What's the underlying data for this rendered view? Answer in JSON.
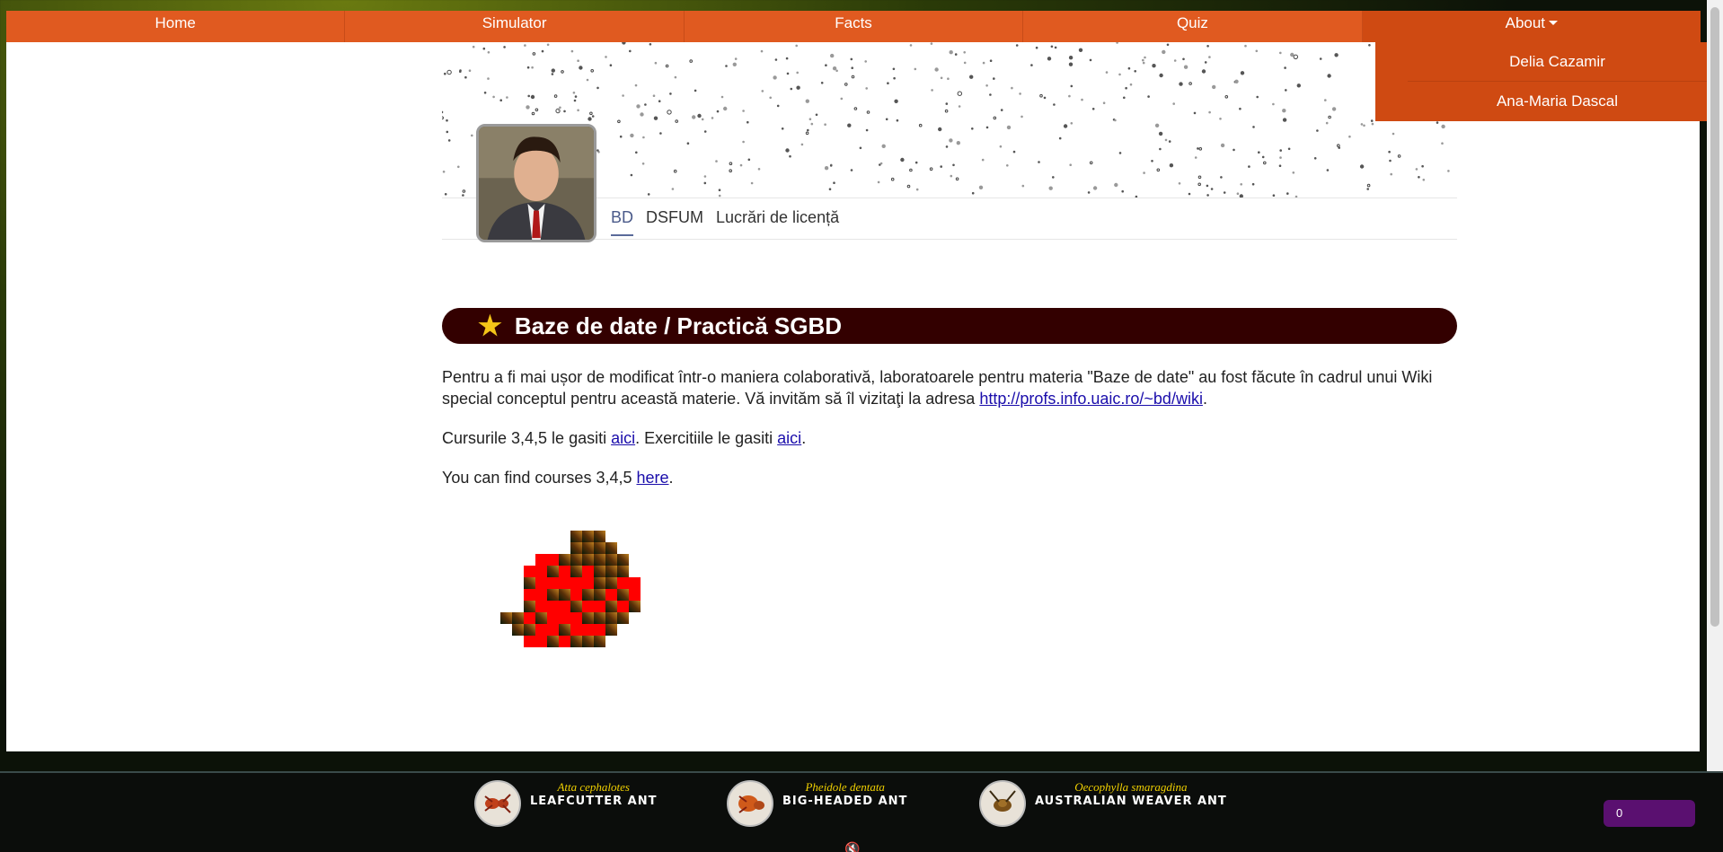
{
  "nav": {
    "items": [
      "Home",
      "Simulator",
      "Facts",
      "Quiz"
    ],
    "about_label": "About"
  },
  "dropdown": {
    "items": [
      "Delia Cazamir",
      "Ana-Maria Dascal"
    ]
  },
  "tabs": [
    {
      "label": "BD",
      "active": true
    },
    {
      "label": "DSFUM",
      "active": false
    },
    {
      "label": "Lucrări de licență",
      "active": false
    }
  ],
  "section": {
    "title": "Baze de date / Practică SGBD"
  },
  "content": {
    "p1_text": "Pentru a fi mai ușor de modificat într-o maniera colaborativă, laboratoarele pentru materia \"Baze de date\" au fost făcute în cadrul unui Wiki special conceptul pentru această materie. Vă invităm să îl vizitaţi la adresa ",
    "p1_link": "http://profs.info.uaic.ro/~bd/wiki",
    "p1_end": ".",
    "p2_text": "Cursurile 3,4,5 le gasiti ",
    "p2_link1": "aici",
    "p2_mid": ". Exercitiile le gasiti ",
    "p2_link2": "aici",
    "p2_end": ".",
    "p3_text": "You can find courses 3,4,5 ",
    "p3_link": "here",
    "p3_end": "."
  },
  "bottom": {
    "ants": [
      {
        "latin": "Atta cephalotes",
        "common": "LEAFCUTTER ANT"
      },
      {
        "latin": "Pheidole dentata",
        "common": "BIG-HEADED ANT"
      },
      {
        "latin": "Oecophylla smaragdina",
        "common": "AUSTRALIAN WEAVER ANT"
      }
    ],
    "counter": "0"
  },
  "colors": {
    "nav": "#e05a20",
    "section_bg": "#330000",
    "star": "#f5c518",
    "counter_bg": "#5a1070"
  }
}
